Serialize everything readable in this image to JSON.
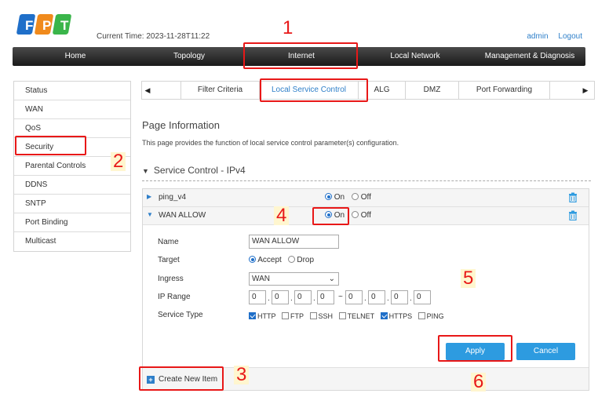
{
  "header": {
    "logo_text": "FPT",
    "current_time_label": "Current Time:",
    "current_time_value": "2023-11-28T11:22",
    "user": "admin",
    "logout": "Logout"
  },
  "mainnav": {
    "items": [
      "Home",
      "Topology",
      "Internet",
      "Local Network",
      "Management & Diagnosis"
    ],
    "active": "Internet"
  },
  "sidebar": {
    "items": [
      "Status",
      "WAN",
      "QoS",
      "Security",
      "Parental Controls",
      "DDNS",
      "SNTP",
      "Port Binding",
      "Multicast"
    ],
    "active": "Security"
  },
  "tabs": {
    "left_arrow": "◀",
    "right_arrow": "▶",
    "items": [
      "Filter Criteria",
      "Local Service Control",
      "ALG",
      "DMZ",
      "Port Forwarding"
    ],
    "active": "Local Service Control"
  },
  "page": {
    "title": "Page Information",
    "description": "This page provides the function of local service control parameter(s) configuration."
  },
  "section": {
    "title": "Service Control - IPv4"
  },
  "rules": [
    {
      "name": "ping_v4",
      "on_label": "On",
      "off_label": "Off",
      "state": "On"
    },
    {
      "name": "WAN ALLOW",
      "on_label": "On",
      "off_label": "Off",
      "state": "On"
    }
  ],
  "form": {
    "name_label": "Name",
    "name_value": "WAN ALLOW",
    "target_label": "Target",
    "target_accept": "Accept",
    "target_drop": "Drop",
    "target_value": "Accept",
    "ingress_label": "Ingress",
    "ingress_value": "WAN",
    "ip_range_label": "IP Range",
    "ip_start": [
      "0",
      "0",
      "0",
      "0"
    ],
    "ip_end": [
      "0",
      "0",
      "0",
      "0"
    ],
    "ip_sep": "~",
    "service_type_label": "Service Type",
    "services": [
      {
        "label": "HTTP",
        "checked": true
      },
      {
        "label": "FTP",
        "checked": false
      },
      {
        "label": "SSH",
        "checked": false
      },
      {
        "label": "TELNET",
        "checked": false
      },
      {
        "label": "HTTPS",
        "checked": true
      },
      {
        "label": "PING",
        "checked": false
      }
    ],
    "apply_label": "Apply",
    "cancel_label": "Cancel"
  },
  "create_new_item": "Create New Item",
  "annotations": [
    "1",
    "2",
    "3",
    "4",
    "5",
    "6"
  ],
  "colors": {
    "accent": "#2e7fc9",
    "button": "#2d9be0",
    "annotation": "#e81818",
    "nav_bg": "#2a2a2a"
  }
}
